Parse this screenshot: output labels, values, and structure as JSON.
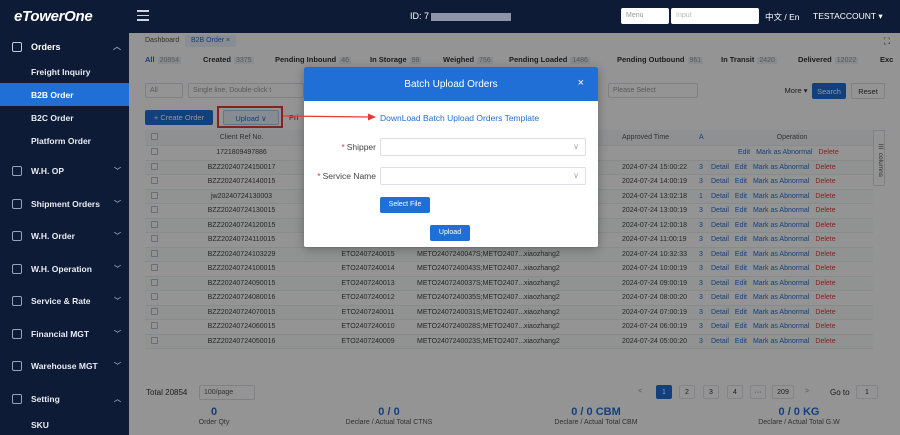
{
  "app": {
    "logo": "eTowerOne"
  },
  "header": {
    "id_label": "ID: 7",
    "menu_placeholder": "Menu",
    "input_placeholder": "Input",
    "language": "中文 / En",
    "account": "TESTACCOUNT ▾"
  },
  "sidebar": {
    "orders_label": "Orders",
    "sub_items": [
      {
        "label": "Freight Inquiry"
      },
      {
        "label": "B2B Order"
      },
      {
        "label": "B2C Order"
      },
      {
        "label": "Platform Order"
      }
    ],
    "items": [
      {
        "label": "W.H. OP"
      },
      {
        "label": "Shipment Orders"
      },
      {
        "label": "W.H. Order"
      },
      {
        "label": "W.H. Operation"
      },
      {
        "label": "Service & Rate"
      },
      {
        "label": "Financial MGT"
      },
      {
        "label": "Warehouse MGT"
      },
      {
        "label": "Setting"
      },
      {
        "label": "SKU"
      }
    ]
  },
  "tabs": {
    "dashboard": "Dashboard",
    "b2b": "B2B Order ×"
  },
  "status": {
    "all": {
      "label": "All",
      "count": "20854"
    },
    "created": {
      "label": "Created",
      "count": "3375"
    },
    "pending_inbound": {
      "label": "Pending Inbound",
      "count": "46"
    },
    "in_storage": {
      "label": "In Storage",
      "count": "98"
    },
    "weighed": {
      "label": "Weighed",
      "count": "756"
    },
    "pending_loaded": {
      "label": "Pending Loaded",
      "count": "1486"
    },
    "pending_outbound": {
      "label": "Pending Outbound",
      "count": "961"
    },
    "in_transit": {
      "label": "In Transit",
      "count": "2420"
    },
    "delivered": {
      "label": "Delivered",
      "count": "12022"
    },
    "exc": {
      "label": "Exc"
    }
  },
  "filter": {
    "all_select": "All",
    "single_line_placeholder": "Single line, Double-click t",
    "please_select": "Please Select",
    "more": "More ▾",
    "search": "Search",
    "reset": "Reset"
  },
  "toolbar": {
    "create_order": "+ Create Order",
    "upload": "Upload ∨",
    "print_partial": "Pri"
  },
  "table": {
    "headers": {
      "ref": "Client Ref No.",
      "approved": "Approved Time",
      "operation": "Operation",
      "a": "A"
    },
    "columns_label": "☰ columns",
    "rows": [
      {
        "ref": "1721809497886",
        "eto": "",
        "meto": "",
        "user": "",
        "time": "",
        "a": "",
        "ops": [
          "Edit",
          "Mark as Abnormal",
          "Delete"
        ]
      },
      {
        "ref": "BZZ20240724150017",
        "eto": "",
        "meto": "",
        "user": "",
        "time": "2024-07-24 15:00:22",
        "a": "3",
        "ops": [
          "Detail",
          "Edit",
          "Mark as Abnormal",
          "Delete"
        ]
      },
      {
        "ref": "BZZ20240724140015",
        "eto": "",
        "meto": "",
        "user": "",
        "time": "2024-07-24 14:00:19",
        "a": "3",
        "ops": [
          "Detail",
          "Edit",
          "Mark as Abnormal",
          "Delete"
        ]
      },
      {
        "ref": "jw20240724130003",
        "eto": "",
        "meto": "",
        "user": "",
        "time": "2024-07-24 13:02:18",
        "a": "1",
        "ops": [
          "Detail",
          "Edit",
          "Mark as Abnormal",
          "Delete"
        ]
      },
      {
        "ref": "BZZ20240724130015",
        "eto": "",
        "meto": "",
        "user": "",
        "time": "2024-07-24 13:00:19",
        "a": "3",
        "ops": [
          "Detail",
          "Edit",
          "Mark as Abnormal",
          "Delete"
        ]
      },
      {
        "ref": "BZZ20240724120015",
        "eto": "",
        "meto": "",
        "user": "",
        "time": "2024-07-24 12:00:18",
        "a": "3",
        "ops": [
          "Detail",
          "Edit",
          "Mark as Abnormal",
          "Delete"
        ]
      },
      {
        "ref": "BZZ20240724110015",
        "eto": "ETO2407240016",
        "meto": "METO2407240049S;METO2407...",
        "user": "xiaozhang2",
        "time": "2024-07-24 11:00:19",
        "a": "3",
        "ops": [
          "Detail",
          "Edit",
          "Mark as Abnormal",
          "Delete"
        ]
      },
      {
        "ref": "BZZ20240724103229",
        "eto": "ETO2407240015",
        "meto": "METO2407240047S;METO2407...",
        "user": "xiaozhang2",
        "time": "2024-07-24 10:32:33",
        "a": "3",
        "ops": [
          "Detail",
          "Edit",
          "Mark as Abnormal",
          "Delete"
        ]
      },
      {
        "ref": "BZZ20240724100015",
        "eto": "ETO2407240014",
        "meto": "METO2407240043S;METO2407...",
        "user": "xiaozhang2",
        "time": "2024-07-24 10:00:19",
        "a": "3",
        "ops": [
          "Detail",
          "Edit",
          "Mark as Abnormal",
          "Delete"
        ]
      },
      {
        "ref": "BZZ20240724090015",
        "eto": "ETO2407240013",
        "meto": "METO2407240037S;METO2407...",
        "user": "xiaozhang2",
        "time": "2024-07-24 09:00:19",
        "a": "3",
        "ops": [
          "Detail",
          "Edit",
          "Mark as Abnormal",
          "Delete"
        ]
      },
      {
        "ref": "BZZ20240724080016",
        "eto": "ETO2407240012",
        "meto": "METO2407240035S;METO2407...",
        "user": "xiaozhang2",
        "time": "2024-07-24 08:00:20",
        "a": "3",
        "ops": [
          "Detail",
          "Edit",
          "Mark as Abnormal",
          "Delete"
        ]
      },
      {
        "ref": "BZZ20240724070015",
        "eto": "ETO2407240011",
        "meto": "METO2407240031S;METO2407...",
        "user": "xiaozhang2",
        "time": "2024-07-24 07:00:19",
        "a": "3",
        "ops": [
          "Detail",
          "Edit",
          "Mark as Abnormal",
          "Delete"
        ]
      },
      {
        "ref": "BZZ20240724060015",
        "eto": "ETO2407240010",
        "meto": "METO2407240028S;METO2407...",
        "user": "xiaozhang2",
        "time": "2024-07-24 06:00:19",
        "a": "3",
        "ops": [
          "Detail",
          "Edit",
          "Mark as Abnormal",
          "Delete"
        ]
      },
      {
        "ref": "BZZ20240724050016",
        "eto": "ETO2407240009",
        "meto": "METO2407240023S;METO2407...",
        "user": "xiaozhang2",
        "time": "2024-07-24 05:00:20",
        "a": "3",
        "ops": [
          "Detail",
          "Edit",
          "Mark as Abnormal",
          "Delete"
        ]
      }
    ]
  },
  "pager": {
    "total": "Total 20854",
    "page_size": "100/page",
    "prev": "<",
    "pages": [
      "1",
      "2",
      "3",
      "4",
      "···",
      "209"
    ],
    "next": ">",
    "goto_label": "Go to",
    "goto_value": "1"
  },
  "totals": [
    {
      "value": "0",
      "label": "Order Qty"
    },
    {
      "value": "0 / 0",
      "label": "Declare / Actual Total CTNS"
    },
    {
      "value": "0 / 0 CBM",
      "label": "Declare / Actual Total CBM"
    },
    {
      "value": "0 / 0 KG",
      "label": "Declare / Actual Total G.W"
    }
  ],
  "modal": {
    "title": "Batch Upload Orders",
    "close": "×",
    "template_link": "DownLoad Batch Upload Orders Template",
    "shipper_label": "Shipper",
    "service_label": "Service Name",
    "required_mark": "*",
    "select_file": "Select File",
    "upload": "Upload"
  },
  "colors": {
    "brand_dark": "#0d1b36",
    "accent": "#1f6fd6",
    "danger": "#e53935"
  }
}
